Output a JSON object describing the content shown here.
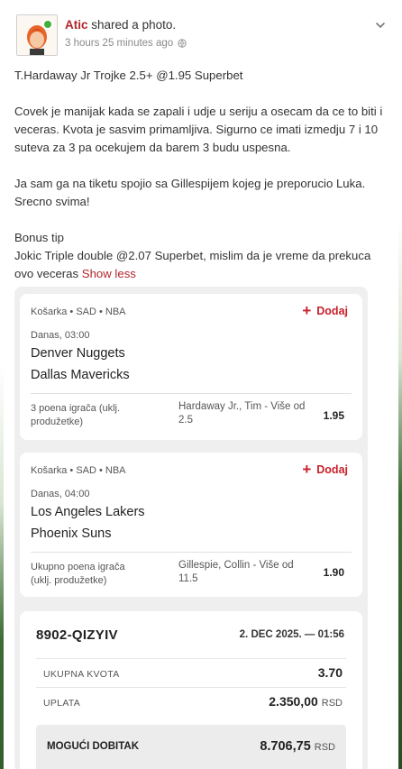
{
  "post": {
    "author": "Atic",
    "action": "shared a photo.",
    "time": "3 hours 25 minutes ago",
    "paragraphs": [
      "T.Hardaway Jr Trojke 2.5+ @1.95 Superbet",
      "Covek je manijak kada se zapali i udje u seriju a osecam da ce to biti i veceras. Kvota je sasvim primamljiva. Sigurno ce imati izmedju 7 i 10 suteva za 3 pa ocekujem da barem 3 budu uspesna.",
      "Ja sam ga na tiketu spojio sa Gillespijem kojeg je preporucio Luka. Srecno svima!"
    ],
    "bonus_line1": "Bonus tip",
    "bonus_line2": "Jokic Triple double @2.07 Superbet, mislim da je vreme da prekuca ovo veceras",
    "show_less": "Show less"
  },
  "ticket": {
    "matches": [
      {
        "meta": "Košarka • SAD • NBA",
        "add_label": "Dodaj",
        "time": "Danas, 03:00",
        "home": "Denver Nuggets",
        "away": "Dallas Mavericks",
        "market": "3 poena igrača (uklj. produžetke)",
        "pick": "Hardaway Jr., Tim - Više od 2.5",
        "odd": "1.95"
      },
      {
        "meta": "Košarka • SAD • NBA",
        "add_label": "Dodaj",
        "time": "Danas, 04:00",
        "home": "Los Angeles Lakers",
        "away": "Phoenix Suns",
        "market": "Ukupno poena igrača (uklj. produžetke)",
        "pick": "Gillespie, Collin - Više od 11.5",
        "odd": "1.90"
      }
    ],
    "summary": {
      "code": "8902-QIZYIV",
      "date": "2. DEC 2025. — 01:56",
      "total_odds_label": "UKUPNA KVOTA",
      "total_odds": "3.70",
      "stake_label": "UPLATA",
      "stake": "2.350,00",
      "possible_win_label": "MOGUĆI DOBITAK",
      "possible_win": "8.706,75",
      "currency": "RSD"
    }
  },
  "colors": {
    "accent": "#b3262b",
    "add_red": "#c8202a",
    "online": "#3fb23a"
  },
  "icons": {
    "globe": "globe-icon",
    "chevron": "chevron-down-icon",
    "plus": "plus-icon"
  }
}
